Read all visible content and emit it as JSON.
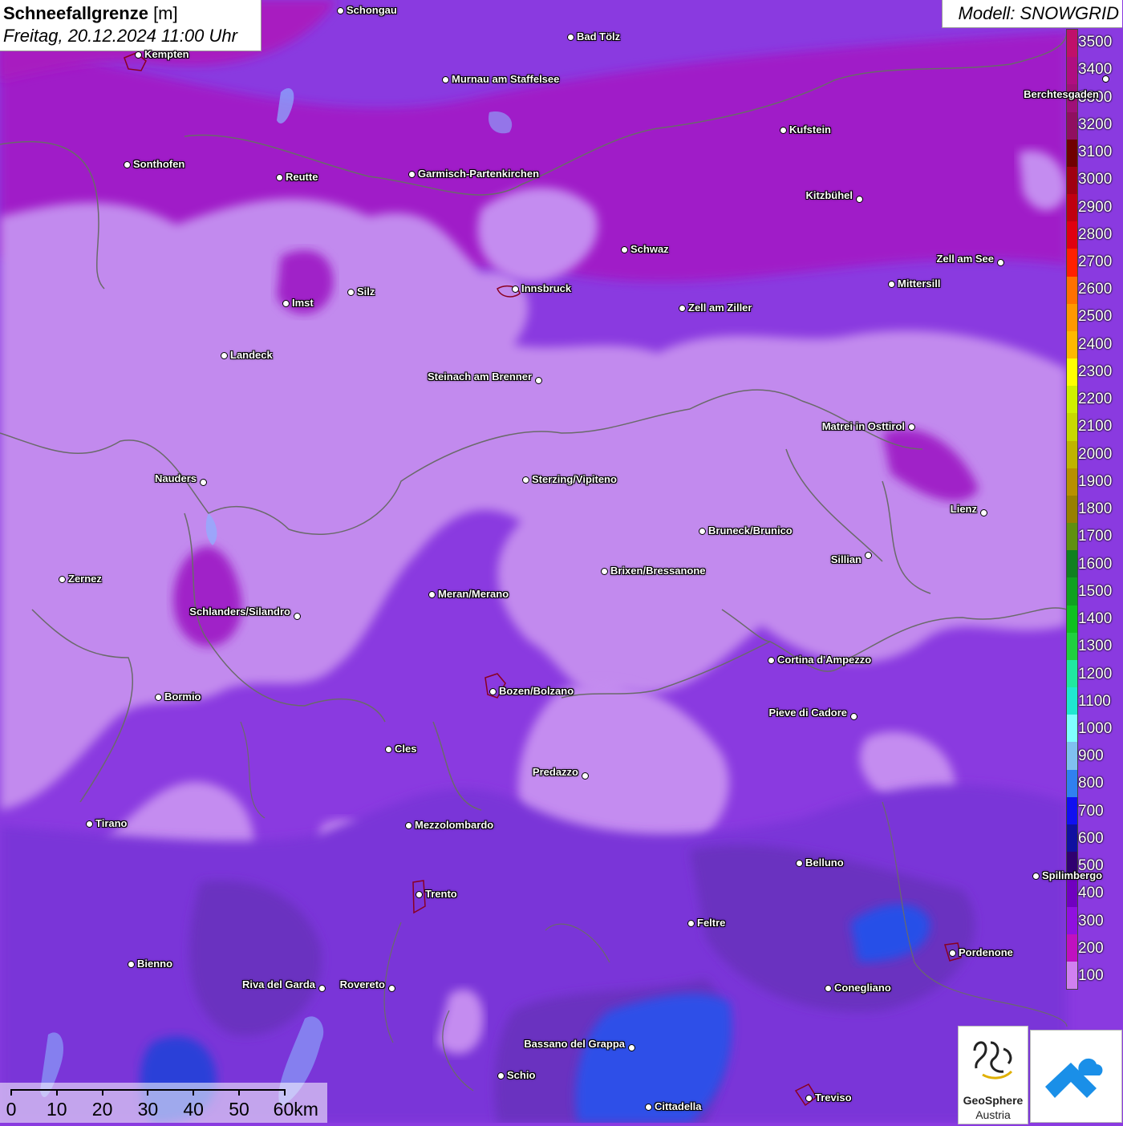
{
  "title": {
    "main": "Schneefallgrenze",
    "unit": " [m]",
    "subtitle": "Freitag, 20.12.2024 11:00 Uhr"
  },
  "model": "Modell: SNOWGRID",
  "legend": {
    "labels": [
      "3500",
      "3400",
      "3300",
      "3200",
      "3100",
      "3000",
      "2900",
      "2800",
      "2700",
      "2600",
      "2500",
      "2400",
      "2300",
      "2200",
      "2100",
      "2000",
      "1900",
      "1800",
      "1700",
      "1600",
      "1500",
      "1400",
      "1300",
      "1200",
      "1100",
      "1000",
      "900",
      "800",
      "700",
      "600",
      "500",
      "400",
      "300",
      "200",
      "100"
    ],
    "colors": [
      "#c0106a",
      "#b00e80",
      "#a01078",
      "#900f60",
      "#700000",
      "#a00010",
      "#c00010",
      "#e00010",
      "#ff2000",
      "#ff7000",
      "#ff9800",
      "#ffb800",
      "#ffff00",
      "#d0f000",
      "#c8d800",
      "#c0b400",
      "#b89000",
      "#988000",
      "#609010",
      "#108020",
      "#10a020",
      "#10c020",
      "#20d040",
      "#20e8a0",
      "#20e8d0",
      "#80ffff",
      "#80c0f0",
      "#3080f0",
      "#1010f0",
      "#1010a0",
      "#300070",
      "#7000c0",
      "#9010e0",
      "#c010c0",
      "#d080f0"
    ]
  },
  "cities": [
    {
      "name": "Schongau"
    },
    {
      "name": "Bad Tölz"
    },
    {
      "name": "Kempten"
    },
    {
      "name": "Murnau am Staffelsee"
    },
    {
      "name": "Berchtesgaden"
    },
    {
      "name": "Kufstein"
    },
    {
      "name": "Sonthofen"
    },
    {
      "name": "Reutte"
    },
    {
      "name": "Garmisch-Partenkirchen"
    },
    {
      "name": "Kitzbühel"
    },
    {
      "name": "Schwaz"
    },
    {
      "name": "Zell am See"
    },
    {
      "name": "Innsbruck"
    },
    {
      "name": "Mittersill"
    },
    {
      "name": "Imst"
    },
    {
      "name": "Silz"
    },
    {
      "name": "Zell am Ziller"
    },
    {
      "name": "Landeck"
    },
    {
      "name": "Steinach am Brenner"
    },
    {
      "name": "Matrei in Osttirol"
    },
    {
      "name": "Nauders"
    },
    {
      "name": "Sterzing/Vipiteno"
    },
    {
      "name": "Lienz"
    },
    {
      "name": "Bruneck/Brunico"
    },
    {
      "name": "Sillian"
    },
    {
      "name": "Zernez"
    },
    {
      "name": "Brixen/Bressanone"
    },
    {
      "name": "Meran/Merano"
    },
    {
      "name": "Schlanders/Silandro"
    },
    {
      "name": "Cortina d'Ampezzo"
    },
    {
      "name": "Bozen/Bolzano"
    },
    {
      "name": "Bormio"
    },
    {
      "name": "Pieve di Cadore"
    },
    {
      "name": "Cles"
    },
    {
      "name": "Predazzo"
    },
    {
      "name": "Tirano"
    },
    {
      "name": "Mezzolombardo"
    },
    {
      "name": "Belluno"
    },
    {
      "name": "Spilimbergo"
    },
    {
      "name": "Trento"
    },
    {
      "name": "Feltre"
    },
    {
      "name": "Pordenone"
    },
    {
      "name": "Bienno"
    },
    {
      "name": "Riva del Garda"
    },
    {
      "name": "Rovereto"
    },
    {
      "name": "Conegliano"
    },
    {
      "name": "Bassano del Grappa"
    },
    {
      "name": "Schio"
    },
    {
      "name": "Treviso"
    },
    {
      "name": "Cittadella"
    }
  ],
  "scalebar": {
    "labels": [
      "0",
      "10",
      "20",
      "30",
      "40",
      "50",
      "60km"
    ]
  },
  "logos": {
    "geosphere_name": "GeoSphere",
    "geosphere_country": "Austria"
  },
  "colors": {
    "deep_purple": "#8a3ae0",
    "light_lilac": "#c48cf0",
    "magenta": "#a020c8",
    "dark_violet": "#6a30c0",
    "blue": "#2040e8"
  }
}
